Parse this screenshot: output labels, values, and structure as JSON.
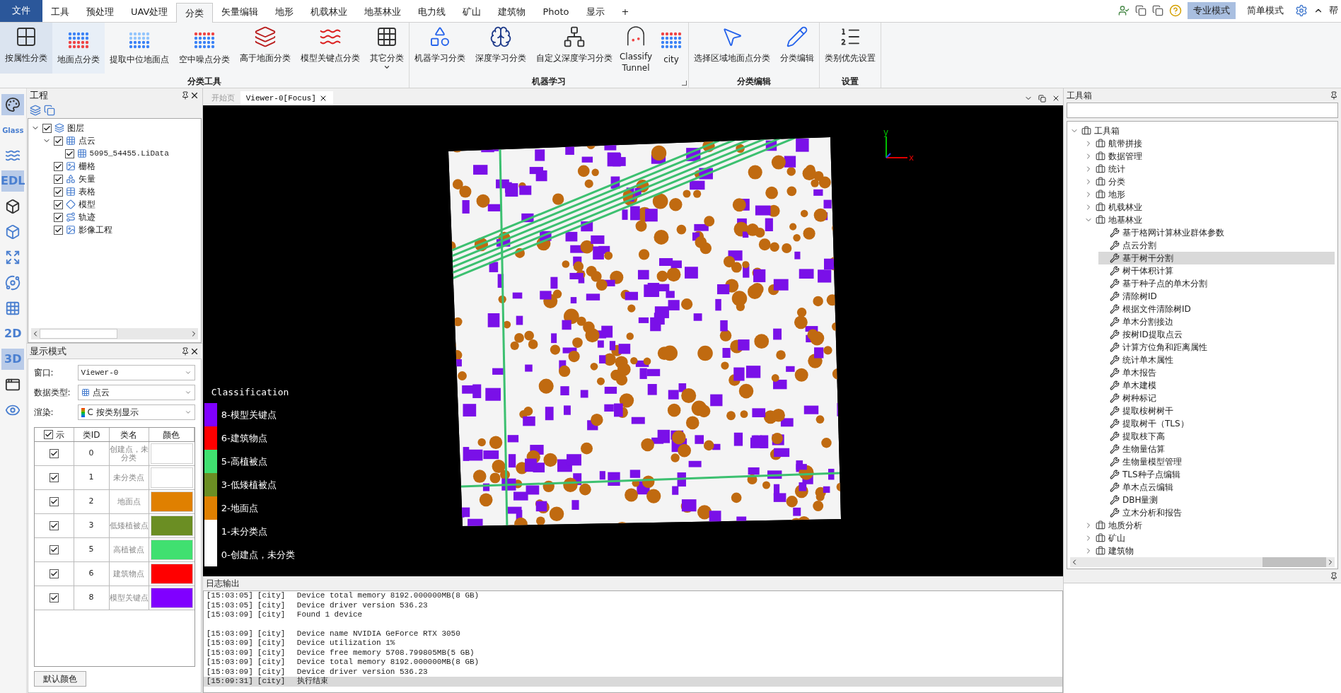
{
  "menu": {
    "file": "文件",
    "tabs": [
      {
        "label": "工具",
        "selected": false
      },
      {
        "label": "预处理",
        "selected": false
      },
      {
        "label": "UAV处理",
        "selected": false
      },
      {
        "label": "分类",
        "selected": true
      },
      {
        "label": "矢量编辑",
        "selected": false
      },
      {
        "label": "地形",
        "selected": false
      },
      {
        "label": "机载林业",
        "selected": false
      },
      {
        "label": "地基林业",
        "selected": false
      },
      {
        "label": "电力线",
        "selected": false
      },
      {
        "label": "矿山",
        "selected": false
      },
      {
        "label": "建筑物",
        "selected": false
      },
      {
        "label": "Photo",
        "selected": false
      },
      {
        "label": "显示",
        "selected": false
      },
      {
        "label": "+",
        "selected": false
      }
    ],
    "modes": [
      {
        "label": "专业模式",
        "selected": true
      },
      {
        "label": "简单模式",
        "selected": false
      }
    ],
    "help": "帮"
  },
  "ribbon": {
    "groups": [
      {
        "title": "分类工具",
        "buttons": [
          {
            "label": "按属性分类",
            "kind": "grid",
            "selected": true
          },
          {
            "label": "地面点分类",
            "kind": "ground",
            "selected": false,
            "hover": true
          },
          {
            "label": "提取中位地面点",
            "kind": "median",
            "selected": false
          },
          {
            "label": "空中噪点分类",
            "kind": "noise",
            "selected": false
          },
          {
            "label": "高于地面分类",
            "kind": "above",
            "selected": false
          },
          {
            "label": "模型关键点分类",
            "kind": "keypoints",
            "selected": false
          },
          {
            "label": "其它分类",
            "kind": "more",
            "selected": false,
            "dropdown": true
          }
        ]
      },
      {
        "title": "机器学习",
        "launcher": true,
        "buttons": [
          {
            "label": "机器学习分类",
            "kind": "ml",
            "selected": false
          },
          {
            "label": "深度学习分类",
            "kind": "dl",
            "selected": false
          },
          {
            "label": "自定义深度学习分类",
            "kind": "customdl",
            "selected": false
          },
          {
            "label": "Classify Tunnel",
            "kind": "tunnel",
            "selected": false
          },
          {
            "label": "city",
            "kind": "city",
            "selected": false
          }
        ]
      },
      {
        "title": "分类编辑",
        "buttons": [
          {
            "label": "选择区域地面点分类",
            "kind": "select",
            "selected": false
          },
          {
            "label": "分类编辑",
            "kind": "edit",
            "selected": false
          }
        ]
      },
      {
        "title": "设置",
        "buttons": [
          {
            "label": "类别优先设置",
            "kind": "priority",
            "selected": false
          }
        ]
      }
    ]
  },
  "left_toolbar": [
    {
      "kind": "palette",
      "selected": true
    },
    {
      "kind": "text",
      "label": "Glass",
      "selected": false
    },
    {
      "kind": "contour",
      "selected": false
    },
    {
      "kind": "text",
      "label": "EDL",
      "selected": true
    },
    {
      "kind": "cube",
      "selected": false
    },
    {
      "kind": "cubeplus",
      "selected": false
    },
    {
      "kind": "expand",
      "selected": false
    },
    {
      "kind": "orbit",
      "selected": false
    },
    {
      "kind": "scatter",
      "selected": false
    },
    {
      "kind": "text",
      "label": "2D",
      "selected": false
    },
    {
      "kind": "text",
      "label": "3D",
      "selected": true
    },
    {
      "kind": "windowplus",
      "selected": false
    },
    {
      "kind": "eyemap",
      "selected": false
    }
  ],
  "project": {
    "title": "工程",
    "tree": [
      {
        "label": "图层",
        "kind": "layers",
        "checked": true,
        "expanded": true,
        "children": [
          {
            "label": "点云",
            "kind": "cloud",
            "checked": true,
            "expanded": true,
            "children": [
              {
                "label": "5095_54455.LiData",
                "kind": "cloud",
                "checked": true
              }
            ]
          },
          {
            "label": "栅格",
            "kind": "raster",
            "checked": true
          },
          {
            "label": "矢量",
            "kind": "vector",
            "checked": true
          },
          {
            "label": "表格",
            "kind": "table",
            "checked": true
          },
          {
            "label": "模型",
            "kind": "model",
            "checked": true
          },
          {
            "label": "轨迹",
            "kind": "track",
            "checked": true
          },
          {
            "label": "影像工程",
            "kind": "image",
            "checked": true
          }
        ]
      }
    ]
  },
  "display_mode": {
    "title": "显示模式",
    "fields": [
      {
        "label": "窗口:",
        "value": "Viewer-0",
        "kind": "plain"
      },
      {
        "label": "数据类型:",
        "value": "点云",
        "kind": "cloud"
      },
      {
        "label": "渲染:",
        "value": "C 按类别显示",
        "kind": "ramp"
      }
    ],
    "table": {
      "header_checked": true,
      "columns": [
        "示",
        "类ID",
        "类名",
        "颜色"
      ],
      "rows": [
        {
          "checked": true,
          "id": "0",
          "name": "创建点，未分类",
          "color": "#ffffff"
        },
        {
          "checked": true,
          "id": "1",
          "name": "未分类点",
          "color": "#ffffff"
        },
        {
          "checked": true,
          "id": "2",
          "name": "地面点",
          "color": "#e08000"
        },
        {
          "checked": true,
          "id": "3",
          "name": "低矮植被点",
          "color": "#6b8e23"
        },
        {
          "checked": true,
          "id": "5",
          "name": "高植被点",
          "color": "#40e070"
        },
        {
          "checked": true,
          "id": "6",
          "name": "建筑物点",
          "color": "#ff0000"
        },
        {
          "checked": true,
          "id": "8",
          "name": "模型关键点",
          "color": "#8000ff"
        }
      ]
    },
    "default_button": "默认颜色"
  },
  "viewer": {
    "tabs": [
      {
        "label": "开始页",
        "selected": false
      },
      {
        "label": "Viewer-0[Focus]",
        "selected": true,
        "closable": true
      }
    ],
    "axes": {
      "x": "x",
      "y": "y"
    },
    "legend": {
      "title": "Classification",
      "items": [
        {
          "label": "8-模型关键点",
          "color": "#8000ff"
        },
        {
          "label": "6-建筑物点",
          "color": "#ff0000"
        },
        {
          "label": "5-高植被点",
          "color": "#40e070"
        },
        {
          "label": "3-低矮植被点",
          "color": "#6b8e23"
        },
        {
          "label": "2-地面点",
          "color": "#e08000"
        },
        {
          "label": "1-未分类点",
          "color": "#ffffff"
        },
        {
          "label": "0-创建点，未分类",
          "color": "#ffffff"
        }
      ]
    }
  },
  "log": {
    "title": "日志输出",
    "lines": [
      {
        "kind": "line",
        "time": "[15:03:05]",
        "source": "[city]",
        "message": "Device total memory 8192.000000MB(8 GB)",
        "selected": false
      },
      {
        "kind": "line",
        "time": "[15:03:05]",
        "source": "[city]",
        "message": "Device driver version 536.23",
        "selected": false
      },
      {
        "kind": "line",
        "time": "[15:03:09]",
        "source": "[city]",
        "message": "Found 1 device",
        "selected": false
      },
      {
        "kind": "gap"
      },
      {
        "kind": "line",
        "time": "[15:03:09]",
        "source": "[city]",
        "message": "Device name NVIDIA GeForce RTX 3050",
        "selected": false
      },
      {
        "kind": "line",
        "time": "[15:03:09]",
        "source": "[city]",
        "message": "Device utilization 1%",
        "selected": false
      },
      {
        "kind": "line",
        "time": "[15:03:09]",
        "source": "[city]",
        "message": "Device free memory 5708.799805MB(5 GB)",
        "selected": false
      },
      {
        "kind": "line",
        "time": "[15:03:09]",
        "source": "[city]",
        "message": "Device total memory 8192.000000MB(8 GB)",
        "selected": false
      },
      {
        "kind": "line",
        "time": "[15:03:09]",
        "source": "[city]",
        "message": "Device driver version 536.23",
        "selected": false
      },
      {
        "kind": "line",
        "time": "[15:09:31]",
        "source": "[city]",
        "message": "执行结束",
        "selected": true
      }
    ]
  },
  "toolbox": {
    "title": "工具箱",
    "tree": [
      {
        "label": "工具箱",
        "kind": "folder",
        "expanded": true,
        "selected": false,
        "children": [
          {
            "label": "航带拼接",
            "kind": "folder",
            "expanded": false,
            "selected": false
          },
          {
            "label": "数据管理",
            "kind": "folder",
            "expanded": false,
            "selected": false
          },
          {
            "label": "统计",
            "kind": "folder",
            "expanded": false,
            "selected": false
          },
          {
            "label": "分类",
            "kind": "folder",
            "expanded": false,
            "selected": false
          },
          {
            "label": "地形",
            "kind": "folder",
            "expanded": false,
            "selected": false
          },
          {
            "label": "机载林业",
            "kind": "folder",
            "expanded": false,
            "selected": false
          },
          {
            "label": "地基林业",
            "kind": "folder",
            "expanded": true,
            "selected": false,
            "children": [
              {
                "label": "基于格网计算林业群体参数",
                "kind": "tool",
                "selected": false
              },
              {
                "label": "点云分割",
                "kind": "tool",
                "selected": false
              },
              {
                "label": "基于树干分割",
                "kind": "tool",
                "selected": true
              },
              {
                "label": "树干体积计算",
                "kind": "tool",
                "selected": false
              },
              {
                "label": "基于种子点的单木分割",
                "kind": "tool",
                "selected": false
              },
              {
                "label": "清除树ID",
                "kind": "tool",
                "selected": false
              },
              {
                "label": "根据文件清除树ID",
                "kind": "tool",
                "selected": false
              },
              {
                "label": "单木分割接边",
                "kind": "tool",
                "selected": false
              },
              {
                "label": "按树ID提取点云",
                "kind": "tool",
                "selected": false
              },
              {
                "label": "计算方位角和距离属性",
                "kind": "tool",
                "selected": false
              },
              {
                "label": "统计单木属性",
                "kind": "tool",
                "selected": false
              },
              {
                "label": "单木报告",
                "kind": "tool",
                "selected": false
              },
              {
                "label": "单木建模",
                "kind": "tool",
                "selected": false
              },
              {
                "label": "树种标记",
                "kind": "tool",
                "selected": false
              },
              {
                "label": "提取桉树树干",
                "kind": "tool",
                "selected": false
              },
              {
                "label": "提取树干（TLS）",
                "kind": "tool",
                "selected": false
              },
              {
                "label": "提取枝下高",
                "kind": "tool",
                "selected": false
              },
              {
                "label": "生物量估算",
                "kind": "tool",
                "selected": false
              },
              {
                "label": "生物量模型管理",
                "kind": "tool",
                "selected": false
              },
              {
                "label": "TLS种子点编辑",
                "kind": "tool",
                "selected": false
              },
              {
                "label": "单木点云编辑",
                "kind": "tool",
                "selected": false
              },
              {
                "label": "DBH量测",
                "kind": "tool",
                "selected": false
              },
              {
                "label": "立木分析和报告",
                "kind": "tool",
                "selected": false
              }
            ]
          },
          {
            "label": "地质分析",
            "kind": "folder",
            "expanded": false,
            "selected": false
          },
          {
            "label": "矿山",
            "kind": "folder",
            "expanded": false,
            "selected": false
          },
          {
            "label": "建筑物",
            "kind": "folder",
            "expanded": false,
            "selected": false
          }
        ]
      }
    ]
  }
}
